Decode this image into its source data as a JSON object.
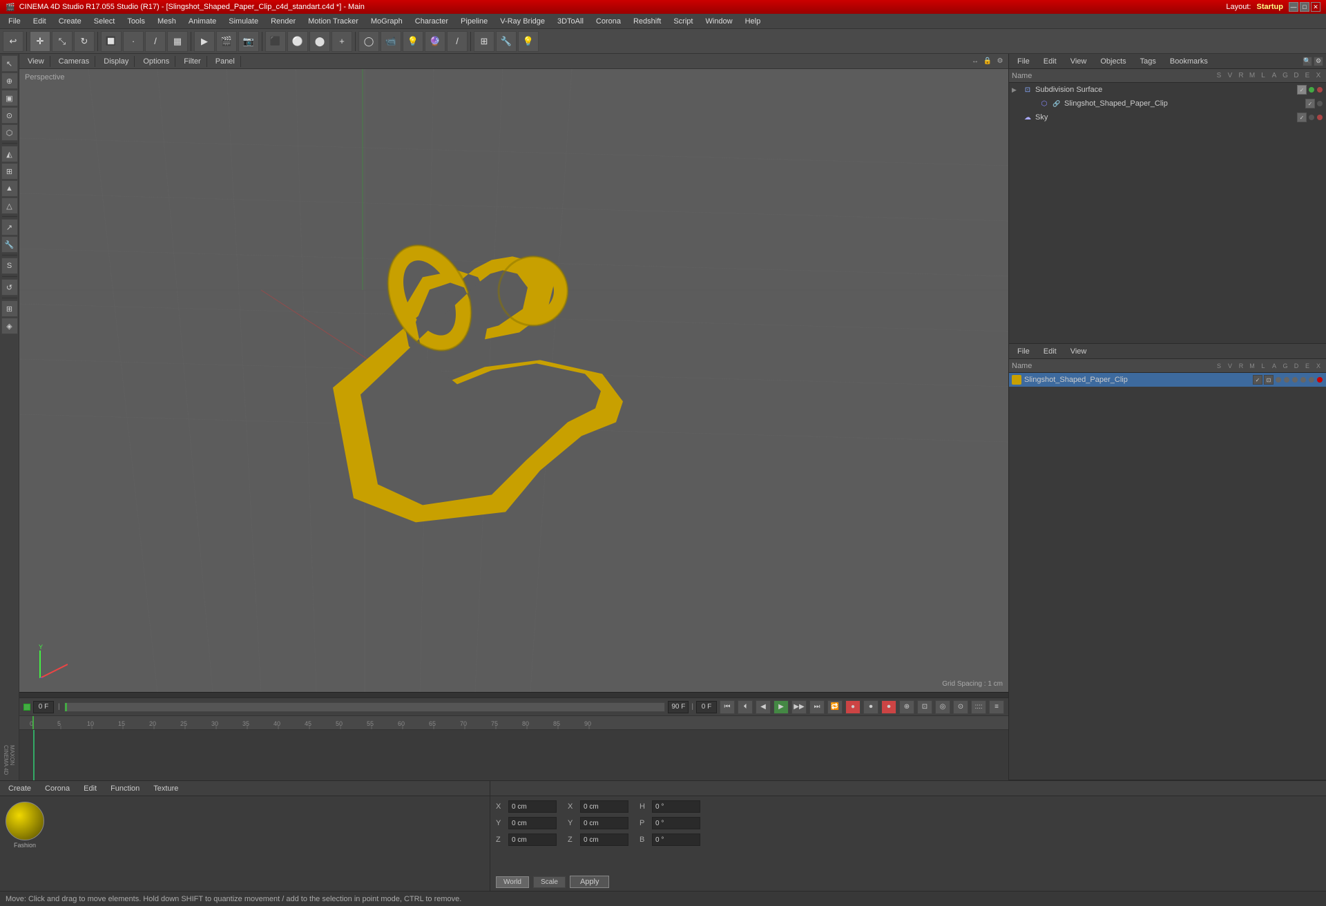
{
  "app": {
    "title": "CINEMA 4D Studio R17.055 Studio (R17) - [Slingshot_Shaped_Paper_Clip_c4d_standart.c4d *] - Main",
    "logo": "MAXON CINEMA 4D"
  },
  "titlebar": {
    "title": "CINEMA 4D Studio R17.055 Studio (R17) - [Slingshot_Shaped_Paper_Clip_c4d_standart.c4d *] - Main",
    "layout_label": "Layout:",
    "layout_value": "Startup",
    "minimize": "—",
    "maximize": "□",
    "close": "✕"
  },
  "menubar": {
    "items": [
      "File",
      "Edit",
      "Create",
      "Select",
      "Tools",
      "Mesh",
      "Animate",
      "Simulate",
      "Render",
      "Motion Tracker",
      "MoGraph",
      "Character",
      "Pipeline",
      "V-Ray Bridge",
      "3DToAll",
      "Corona",
      "Redshift",
      "Script",
      "Window",
      "Help"
    ]
  },
  "viewport": {
    "label": "Perspective",
    "grid_spacing": "Grid Spacing : 1 cm",
    "tabs": [
      "View",
      "Cameras",
      "Display",
      "Options",
      "Filter",
      "Panel"
    ]
  },
  "hierarchy": {
    "tabs": [
      "File",
      "Edit",
      "View",
      "Objects",
      "Tags",
      "Bookmarks"
    ],
    "columns": {
      "name": "Name",
      "s": "S",
      "v": "V",
      "r": "R",
      "m": "M",
      "l": "L",
      "a": "A",
      "g": "G",
      "d": "D",
      "e": "E",
      "x": "X"
    },
    "items": [
      {
        "name": "Subdivision Surface",
        "type": "subdivision",
        "indent": 0,
        "has_arrow": true,
        "active": true
      },
      {
        "name": "Slingshot_Shaped_Paper_Clip",
        "type": "object",
        "indent": 1,
        "has_arrow": false,
        "active": false
      },
      {
        "name": "Sky",
        "type": "sky",
        "indent": 0,
        "has_arrow": false,
        "active": false
      }
    ]
  },
  "material_panel": {
    "tabs": [
      "File",
      "Edit",
      "View"
    ],
    "columns": {
      "name": "Name",
      "s": "S",
      "v": "V",
      "r": "R",
      "m": "M",
      "l": "L",
      "a": "A",
      "g": "G",
      "d": "D",
      "e": "E",
      "x": "X"
    },
    "items": [
      {
        "name": "Slingshot_Shaped_Paper_Clip",
        "color": "#c8a000",
        "selected": true
      }
    ]
  },
  "mat_editor": {
    "tabs": [
      "Create",
      "Corona",
      "Edit",
      "Function",
      "Texture"
    ],
    "material_name": "Fashion",
    "ball_color_start": "#f0d800",
    "ball_color_end": "#504800"
  },
  "coordinates": {
    "x_label": "X",
    "y_label": "Y",
    "z_label": "Z",
    "x_pos": "0 cm",
    "y_pos": "0 cm",
    "z_pos": "0 cm",
    "h_label": "H",
    "p_label": "P",
    "b_label": "B",
    "h_val": "0 °",
    "p_val": "0 °",
    "b_val": "0 °",
    "s_label": "Scale",
    "mode_world": "World",
    "mode_apply": "Apply",
    "mode_scale": "Scale"
  },
  "timeline": {
    "start_frame": "0 F",
    "end_frame": "90 F",
    "current_frame": "0 F",
    "fps": "0 F",
    "ruler_marks": [
      0,
      5,
      10,
      15,
      20,
      25,
      30,
      35,
      40,
      45,
      50,
      55,
      60,
      65,
      70,
      75,
      80,
      85,
      90
    ]
  },
  "playback": {
    "buttons": [
      "⏮",
      "⏭",
      "◀",
      "▶",
      "▶▶",
      "⏹",
      "🔁"
    ]
  },
  "statusbar": {
    "message": "Move: Click and drag to move elements. Hold down SHIFT to quantize movement / add to the selection in point mode, CTRL to remove."
  }
}
